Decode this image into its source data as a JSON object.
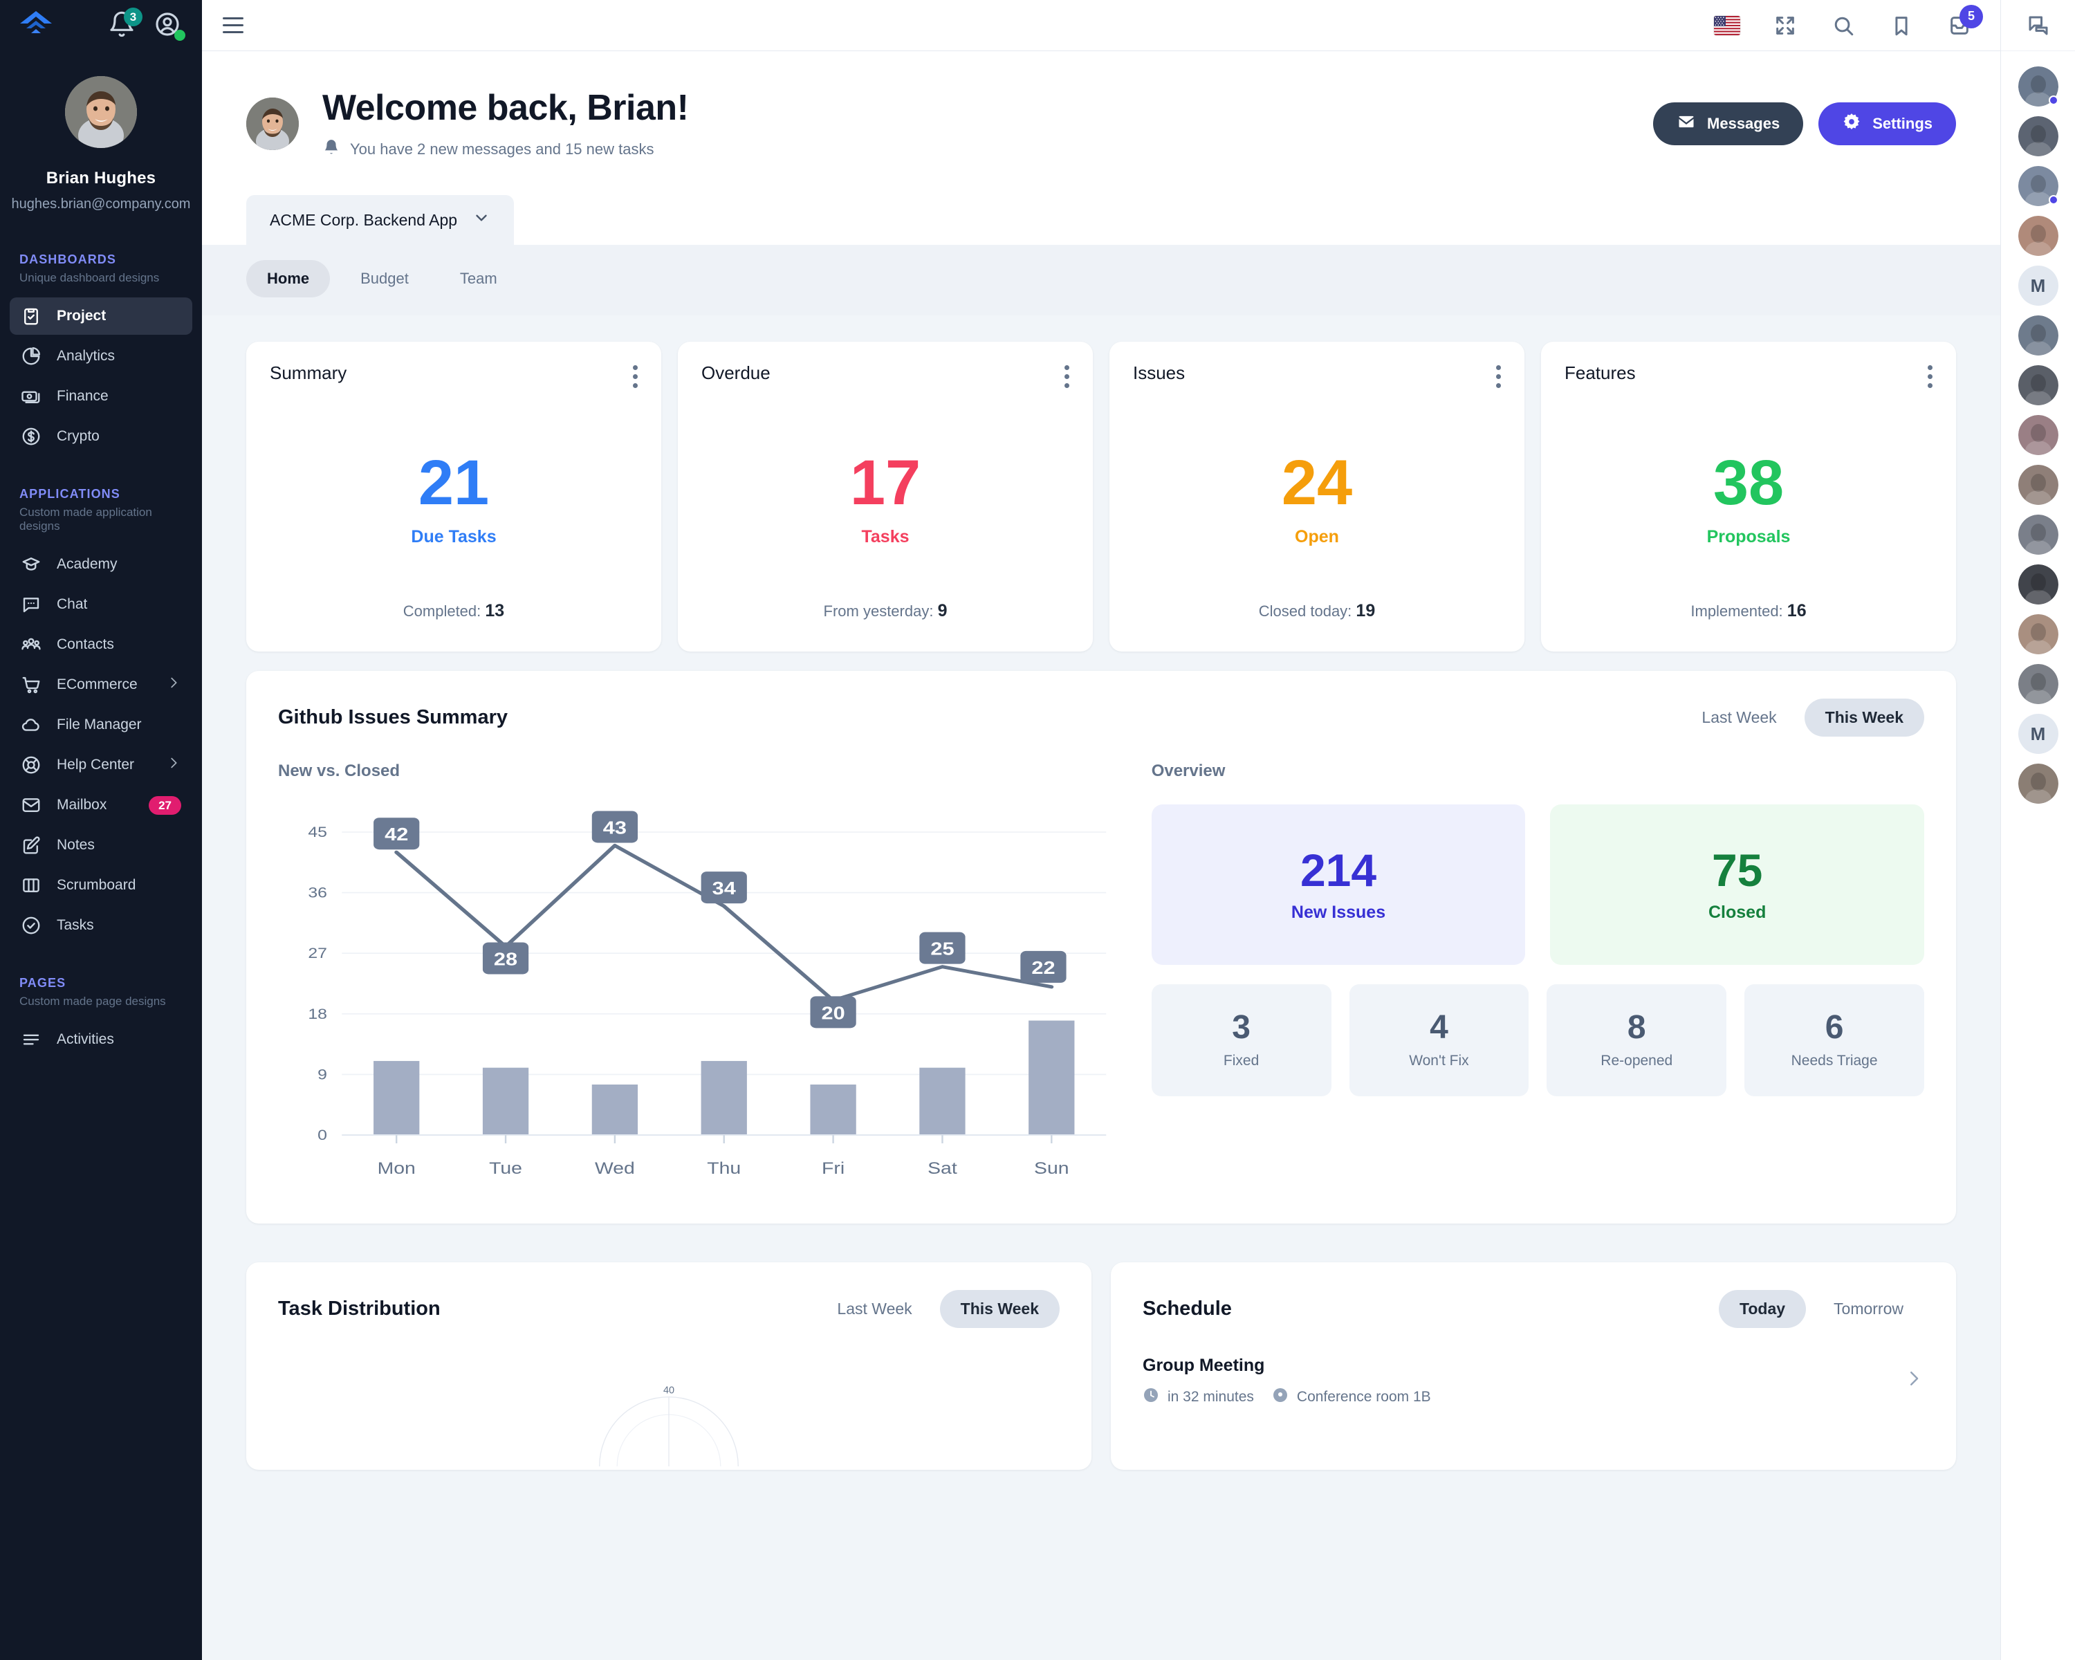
{
  "brand": {
    "logo_name": "fuse-logo",
    "accent": "#4f46e5",
    "sidebar_bg": "#111827"
  },
  "sidebar": {
    "notifications_badge": "3",
    "profile": {
      "name": "Brian Hughes",
      "email": "hughes.brian@company.com"
    },
    "sections": [
      {
        "title": "DASHBOARDS",
        "subtitle": "Unique dashboard designs",
        "items": [
          {
            "label": "Project",
            "icon": "clipboard-check-icon",
            "active": true
          },
          {
            "label": "Analytics",
            "icon": "pie-chart-icon",
            "active": false
          },
          {
            "label": "Finance",
            "icon": "banknote-icon",
            "active": false
          },
          {
            "label": "Crypto",
            "icon": "dollar-circle-icon",
            "active": false
          }
        ]
      },
      {
        "title": "APPLICATIONS",
        "subtitle": "Custom made application designs",
        "items": [
          {
            "label": "Academy",
            "icon": "graduation-cap-icon",
            "active": false
          },
          {
            "label": "Chat",
            "icon": "chat-bubble-icon",
            "active": false
          },
          {
            "label": "Contacts",
            "icon": "users-icon",
            "active": false
          },
          {
            "label": "ECommerce",
            "icon": "shopping-cart-icon",
            "active": false,
            "chevron": true
          },
          {
            "label": "File Manager",
            "icon": "cloud-icon",
            "active": false
          },
          {
            "label": "Help Center",
            "icon": "lifebuoy-icon",
            "active": false,
            "chevron": true
          },
          {
            "label": "Mailbox",
            "icon": "envelope-icon",
            "active": false,
            "badge": "27"
          },
          {
            "label": "Notes",
            "icon": "pencil-square-icon",
            "active": false
          },
          {
            "label": "Scrumboard",
            "icon": "columns-icon",
            "active": false
          },
          {
            "label": "Tasks",
            "icon": "check-circle-icon",
            "active": false
          }
        ]
      },
      {
        "title": "PAGES",
        "subtitle": "Custom made page designs",
        "items": [
          {
            "label": "Activities",
            "icon": "list-icon",
            "active": false
          }
        ]
      }
    ]
  },
  "topbar": {
    "menu_icon": "hamburger-icon",
    "icons": [
      {
        "name": "language-flag-usa-icon"
      },
      {
        "name": "fullscreen-icon"
      },
      {
        "name": "search-icon"
      },
      {
        "name": "bookmark-icon"
      },
      {
        "name": "inbox-icon",
        "badge": "5"
      }
    ],
    "chat_panel_icon": "chat-panel-icon"
  },
  "hero": {
    "title": "Welcome back, Brian!",
    "subtitle": "You have 2 new messages and 15 new tasks",
    "bell_icon": "bell-filled-icon",
    "buttons": [
      {
        "label": "Messages",
        "icon": "envelope-icon",
        "style": "dark"
      },
      {
        "label": "Settings",
        "icon": "gear-icon",
        "style": "primary"
      }
    ]
  },
  "project_tab": {
    "label": "ACME Corp. Backend App",
    "chevron_icon": "chevron-down-icon"
  },
  "subtabs": [
    {
      "label": "Home",
      "active": true
    },
    {
      "label": "Budget",
      "active": false
    },
    {
      "label": "Team",
      "active": false
    }
  ],
  "stat_cards": [
    {
      "title": "Summary",
      "value": "21",
      "label": "Due Tasks",
      "foot_label": "Completed:",
      "foot_value": "13",
      "color": "#2f7df6"
    },
    {
      "title": "Overdue",
      "value": "17",
      "label": "Tasks",
      "foot_label": "From yesterday:",
      "foot_value": "9",
      "color": "#f43f5e"
    },
    {
      "title": "Issues",
      "value": "24",
      "label": "Open",
      "foot_label": "Closed today:",
      "foot_value": "19",
      "color": "#f59e0b"
    },
    {
      "title": "Features",
      "value": "38",
      "label": "Proposals",
      "foot_label": "Implemented:",
      "foot_value": "16",
      "color": "#22c55e"
    }
  ],
  "github": {
    "title": "Github Issues Summary",
    "toggle": [
      {
        "label": "Last Week",
        "active": false
      },
      {
        "label": "This Week",
        "active": true
      }
    ],
    "left_label": "New vs. Closed",
    "right_label": "Overview",
    "overview_big": [
      {
        "value": "214",
        "label": "New Issues",
        "variant": "blue"
      },
      {
        "value": "75",
        "label": "Closed",
        "variant": "green"
      }
    ],
    "overview_small": [
      {
        "value": "3",
        "label": "Fixed"
      },
      {
        "value": "4",
        "label": "Won't Fix"
      },
      {
        "value": "8",
        "label": "Re-opened"
      },
      {
        "value": "6",
        "label": "Needs Triage"
      }
    ]
  },
  "chart_data": {
    "type": "line",
    "title": "New vs. Closed",
    "xlabel": "",
    "ylabel": "",
    "categories": [
      "Mon",
      "Tue",
      "Wed",
      "Thu",
      "Fri",
      "Sat",
      "Sun"
    ],
    "yticks": [
      0,
      9,
      18,
      27,
      36,
      45
    ],
    "ylim": [
      0,
      45
    ],
    "grid": true,
    "legend": "none",
    "series": [
      {
        "name": "New",
        "type": "line",
        "values": [
          42,
          28,
          43,
          34,
          20,
          25,
          22
        ],
        "labels": [
          "42",
          "28",
          "43",
          "34",
          "20",
          "25",
          "22"
        ],
        "color": "#64748b"
      },
      {
        "name": "Closed",
        "type": "bar",
        "values": [
          11,
          10,
          7.5,
          11,
          7.5,
          10,
          17
        ],
        "color": "#a3aec4"
      }
    ]
  },
  "task_distribution": {
    "title": "Task Distribution",
    "toggle": [
      {
        "label": "Last Week",
        "active": false
      },
      {
        "label": "This Week",
        "active": true
      }
    ],
    "axis_max_label": "40"
  },
  "schedule": {
    "title": "Schedule",
    "toggle": [
      {
        "label": "Today",
        "active": true
      },
      {
        "label": "Tomorrow",
        "active": false
      }
    ],
    "items": [
      {
        "title": "Group Meeting",
        "time": "in 32 minutes",
        "location": "Conference room 1B",
        "clock_icon": "clock-icon",
        "location_icon": "location-pin-icon",
        "chevron_icon": "chevron-right-icon"
      }
    ]
  },
  "rail": {
    "contacts": [
      {
        "initial": "",
        "status": "busy",
        "photo": "#6b7a8f"
      },
      {
        "initial": "",
        "status": "none",
        "photo": "#5c6472"
      },
      {
        "initial": "",
        "status": "busy",
        "photo": "#7c8aa0"
      },
      {
        "initial": "",
        "status": "none",
        "photo": "#b08a7a"
      },
      {
        "initial": "M",
        "status": "none",
        "photo": ""
      },
      {
        "initial": "",
        "status": "none",
        "photo": "#6e7b8c"
      },
      {
        "initial": "",
        "status": "none",
        "photo": "#5a5f68"
      },
      {
        "initial": "",
        "status": "none",
        "photo": "#9a7f85"
      },
      {
        "initial": "",
        "status": "none",
        "photo": "#8f7f78"
      },
      {
        "initial": "",
        "status": "none",
        "photo": "#7a7f8a"
      },
      {
        "initial": "",
        "status": "none",
        "photo": "#41444b"
      },
      {
        "initial": "",
        "status": "none",
        "photo": "#a98f80"
      },
      {
        "initial": "",
        "status": "none",
        "photo": "#7b7f87"
      },
      {
        "initial": "M",
        "status": "none",
        "photo": ""
      },
      {
        "initial": "",
        "status": "none",
        "photo": "#8b7e74"
      }
    ]
  }
}
